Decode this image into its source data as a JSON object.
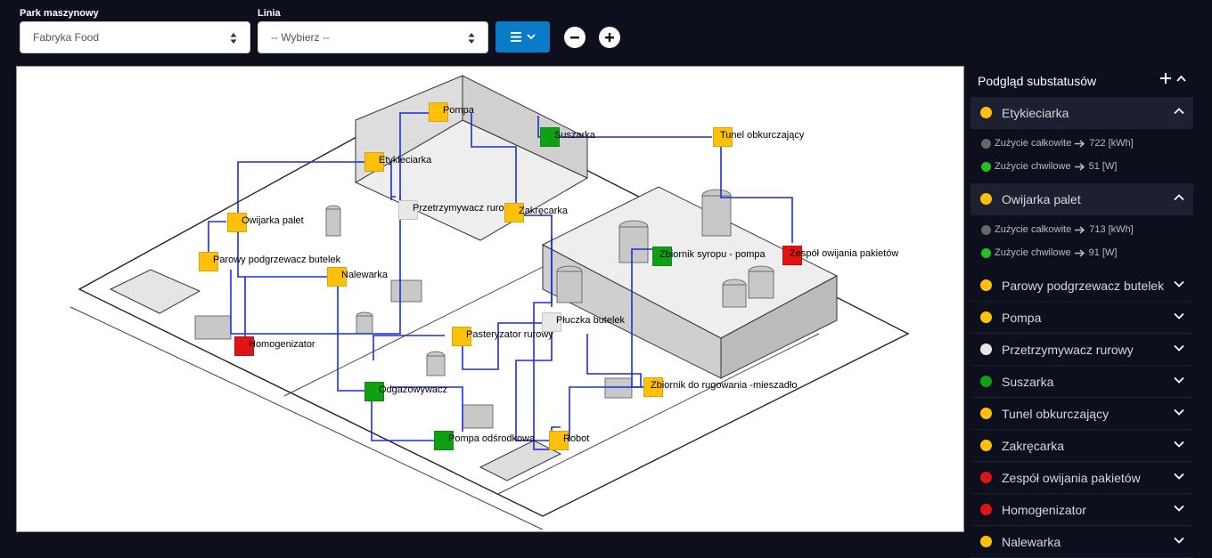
{
  "filters": {
    "park_label": "Park maszynowy",
    "park_value": "Fabryka Food",
    "line_label": "Linia",
    "line_value": "-- Wybierz --"
  },
  "colors": {
    "yellow": "#ffc107",
    "green": "#11a011",
    "red": "#e11414",
    "white": "#e8e8e8",
    "accent": "#0a7bc6",
    "line": "#1b2fd0"
  },
  "map": {
    "nodes": [
      {
        "name": "Pompa",
        "status": "yellow"
      },
      {
        "name": "Suszarka",
        "status": "green"
      },
      {
        "name": "Tunel obkurczający",
        "status": "yellow"
      },
      {
        "name": "Etykieciarka",
        "status": "yellow"
      },
      {
        "name": "Przetrzymywacz rurowy",
        "status": "white"
      },
      {
        "name": "Zakręcarka",
        "status": "yellow"
      },
      {
        "name": "Owijarka palet",
        "status": "yellow"
      },
      {
        "name": "Parowy podgrzewacz butelek",
        "status": "yellow"
      },
      {
        "name": "Nalewarka",
        "status": "yellow"
      },
      {
        "name": "Zbiornik syropu - pompa",
        "status": "green"
      },
      {
        "name": "Zespół owijania pakietów",
        "status": "red"
      },
      {
        "name": "Płuczka butelek",
        "status": "white"
      },
      {
        "name": "Pasteryzator rurowy",
        "status": "yellow"
      },
      {
        "name": "Homogenizator",
        "status": "red"
      },
      {
        "name": "Odgazowywacz",
        "status": "green"
      },
      {
        "name": "Zbiornik do rugowania -mieszadło",
        "status": "yellow"
      },
      {
        "name": "Pompa odśrodkowa",
        "status": "green"
      },
      {
        "name": "Robot",
        "status": "yellow"
      }
    ]
  },
  "panel": {
    "title": "Podgląd substatusów",
    "items": [
      {
        "name": "Etykieciarka",
        "status": "yellow",
        "expanded": true,
        "total_label": "Zużycie całkowite",
        "total_value": "722 [kWh]",
        "inst_label": "Zużycie chwilowe",
        "inst_value": "51 [W]"
      },
      {
        "name": "Owijarka palet",
        "status": "yellow",
        "expanded": true,
        "total_label": "Zużycie całkowite",
        "total_value": "713 [kWh]",
        "inst_label": "Zużycie chwilowe",
        "inst_value": "91 [W]"
      },
      {
        "name": "Parowy podgrzewacz butelek",
        "status": "yellow"
      },
      {
        "name": "Pompa",
        "status": "yellow"
      },
      {
        "name": "Przetrzymywacz rurowy",
        "status": "white"
      },
      {
        "name": "Suszarka",
        "status": "green"
      },
      {
        "name": "Tunel obkurczający",
        "status": "yellow"
      },
      {
        "name": "Zakręcarka",
        "status": "yellow"
      },
      {
        "name": "Zespół owijania pakietów",
        "status": "red"
      },
      {
        "name": "Homogenizator",
        "status": "red"
      },
      {
        "name": "Nalewarka",
        "status": "yellow"
      }
    ]
  }
}
